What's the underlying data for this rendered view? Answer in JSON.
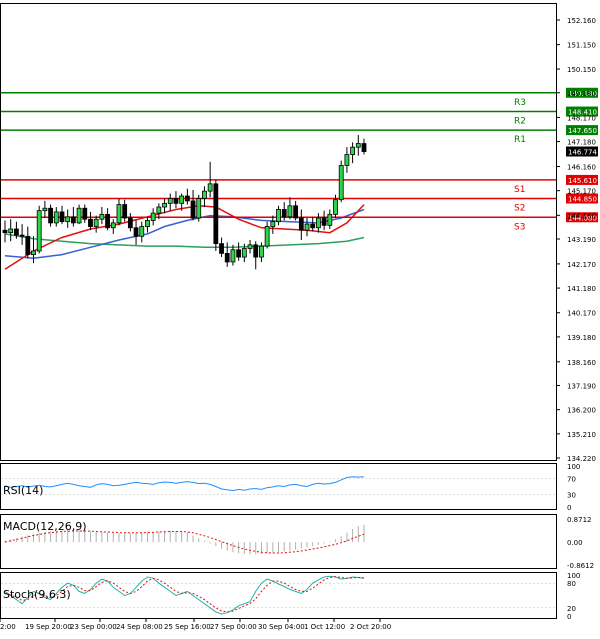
{
  "chart_data": {
    "type": "candlestick",
    "title": "",
    "price_axis": {
      "ticks": [
        "152.160",
        "151.150",
        "150.150",
        "149.180",
        "148.170",
        "147.180",
        "146.160",
        "145.170",
        "144.160",
        "143.190",
        "142.170",
        "141.180",
        "140.170",
        "139.180",
        "138.160",
        "137.190",
        "136.200",
        "135.210",
        "134.220"
      ],
      "ylim": [
        134.22,
        152.16
      ]
    },
    "time_axis": {
      "labels": [
        "2:00",
        "19 Sep 20:00",
        "23 Sep 00:00",
        "24 Sep 08:00",
        "25 Sep 16:00",
        "27 Sep 00:00",
        "30 Sep 04:00",
        "1 Oct 12:00",
        "2 Oct 20:00"
      ]
    },
    "current_price": "146.774",
    "levels": [
      {
        "name": "R3",
        "value": "149.180",
        "color": "#008000"
      },
      {
        "name": "R2",
        "value": "148.410",
        "color": "#008000"
      },
      {
        "name": "R1",
        "value": "147.650",
        "color": "#008000"
      },
      {
        "name": "S1",
        "value": "145.610",
        "color": "#e00000"
      },
      {
        "name": "S2",
        "value": "144.850",
        "color": "#e00000"
      },
      {
        "name": "S3",
        "value": "144.080",
        "color": "#e00000"
      }
    ],
    "candles": [
      {
        "o": 143.55,
        "h": 143.95,
        "l": 143.05,
        "c": 143.45
      },
      {
        "o": 143.45,
        "h": 144.0,
        "l": 143.1,
        "c": 143.6
      },
      {
        "o": 143.6,
        "h": 143.9,
        "l": 143.2,
        "c": 143.35
      },
      {
        "o": 143.35,
        "h": 143.8,
        "l": 142.95,
        "c": 143.3
      },
      {
        "o": 143.3,
        "h": 143.7,
        "l": 142.4,
        "c": 142.55
      },
      {
        "o": 142.55,
        "h": 143.3,
        "l": 142.2,
        "c": 142.7
      },
      {
        "o": 142.7,
        "h": 144.55,
        "l": 142.6,
        "c": 144.35
      },
      {
        "o": 144.35,
        "h": 144.75,
        "l": 144.05,
        "c": 144.45
      },
      {
        "o": 144.45,
        "h": 144.6,
        "l": 143.7,
        "c": 143.85
      },
      {
        "o": 143.85,
        "h": 144.5,
        "l": 143.7,
        "c": 144.3
      },
      {
        "o": 144.3,
        "h": 144.55,
        "l": 143.8,
        "c": 143.9
      },
      {
        "o": 143.9,
        "h": 144.4,
        "l": 143.65,
        "c": 144.1
      },
      {
        "o": 144.1,
        "h": 144.5,
        "l": 143.7,
        "c": 143.85
      },
      {
        "o": 143.85,
        "h": 144.6,
        "l": 143.8,
        "c": 144.45
      },
      {
        "o": 144.45,
        "h": 144.6,
        "l": 143.85,
        "c": 144.0
      },
      {
        "o": 144.0,
        "h": 144.3,
        "l": 143.55,
        "c": 143.7
      },
      {
        "o": 143.7,
        "h": 144.15,
        "l": 143.45,
        "c": 144.0
      },
      {
        "o": 144.0,
        "h": 144.5,
        "l": 143.8,
        "c": 144.2
      },
      {
        "o": 144.2,
        "h": 144.45,
        "l": 143.55,
        "c": 143.65
      },
      {
        "o": 143.65,
        "h": 144.0,
        "l": 143.4,
        "c": 143.85
      },
      {
        "o": 143.85,
        "h": 144.85,
        "l": 143.75,
        "c": 144.6
      },
      {
        "o": 144.6,
        "h": 144.8,
        "l": 143.9,
        "c": 144.05
      },
      {
        "o": 144.05,
        "h": 144.25,
        "l": 143.5,
        "c": 143.65
      },
      {
        "o": 143.65,
        "h": 143.95,
        "l": 142.95,
        "c": 143.3
      },
      {
        "o": 143.3,
        "h": 143.9,
        "l": 143.05,
        "c": 143.7
      },
      {
        "o": 143.7,
        "h": 144.1,
        "l": 143.45,
        "c": 143.95
      },
      {
        "o": 143.95,
        "h": 144.45,
        "l": 143.75,
        "c": 144.25
      },
      {
        "o": 144.25,
        "h": 144.65,
        "l": 144.0,
        "c": 144.5
      },
      {
        "o": 144.5,
        "h": 144.85,
        "l": 144.25,
        "c": 144.65
      },
      {
        "o": 144.65,
        "h": 145.05,
        "l": 144.35,
        "c": 144.85
      },
      {
        "o": 144.85,
        "h": 145.15,
        "l": 144.45,
        "c": 144.65
      },
      {
        "o": 144.65,
        "h": 145.05,
        "l": 144.35,
        "c": 144.95
      },
      {
        "o": 144.95,
        "h": 145.25,
        "l": 144.6,
        "c": 144.75
      },
      {
        "o": 144.75,
        "h": 145.2,
        "l": 143.95,
        "c": 144.05
      },
      {
        "o": 144.05,
        "h": 145.0,
        "l": 143.9,
        "c": 144.85
      },
      {
        "o": 144.85,
        "h": 145.35,
        "l": 144.5,
        "c": 145.15
      },
      {
        "o": 145.15,
        "h": 146.35,
        "l": 144.9,
        "c": 145.45
      },
      {
        "o": 145.45,
        "h": 145.6,
        "l": 142.7,
        "c": 143.0
      },
      {
        "o": 143.0,
        "h": 143.25,
        "l": 142.45,
        "c": 142.6
      },
      {
        "o": 142.6,
        "h": 143.05,
        "l": 142.05,
        "c": 142.25
      },
      {
        "o": 142.25,
        "h": 142.95,
        "l": 142.1,
        "c": 142.75
      },
      {
        "o": 142.75,
        "h": 143.05,
        "l": 142.3,
        "c": 142.45
      },
      {
        "o": 142.45,
        "h": 143.0,
        "l": 142.25,
        "c": 142.8
      },
      {
        "o": 142.8,
        "h": 143.15,
        "l": 142.6,
        "c": 142.95
      },
      {
        "o": 142.95,
        "h": 143.1,
        "l": 141.95,
        "c": 142.45
      },
      {
        "o": 142.45,
        "h": 143.05,
        "l": 142.25,
        "c": 142.9
      },
      {
        "o": 142.9,
        "h": 143.9,
        "l": 142.8,
        "c": 143.7
      },
      {
        "o": 143.7,
        "h": 144.15,
        "l": 143.4,
        "c": 143.9
      },
      {
        "o": 143.9,
        "h": 144.55,
        "l": 143.75,
        "c": 144.4
      },
      {
        "o": 144.4,
        "h": 144.7,
        "l": 143.95,
        "c": 144.1
      },
      {
        "o": 144.1,
        "h": 144.9,
        "l": 144.0,
        "c": 144.55
      },
      {
        "o": 144.55,
        "h": 144.75,
        "l": 143.95,
        "c": 144.05
      },
      {
        "o": 144.05,
        "h": 144.4,
        "l": 143.15,
        "c": 143.55
      },
      {
        "o": 143.55,
        "h": 144.05,
        "l": 143.3,
        "c": 143.8
      },
      {
        "o": 143.8,
        "h": 144.1,
        "l": 143.5,
        "c": 143.65
      },
      {
        "o": 143.65,
        "h": 144.25,
        "l": 143.45,
        "c": 144.05
      },
      {
        "o": 144.05,
        "h": 144.35,
        "l": 143.55,
        "c": 143.75
      },
      {
        "o": 143.75,
        "h": 144.4,
        "l": 143.6,
        "c": 144.2
      },
      {
        "o": 144.2,
        "h": 145.0,
        "l": 144.05,
        "c": 144.8
      },
      {
        "o": 144.8,
        "h": 146.4,
        "l": 144.7,
        "c": 146.2
      },
      {
        "o": 146.2,
        "h": 146.95,
        "l": 145.9,
        "c": 146.65
      },
      {
        "o": 146.65,
        "h": 147.15,
        "l": 146.3,
        "c": 146.95
      },
      {
        "o": 146.95,
        "h": 147.45,
        "l": 146.6,
        "c": 147.1
      },
      {
        "o": 147.1,
        "h": 147.3,
        "l": 146.65,
        "c": 146.77
      }
    ],
    "ma_blue": [
      [
        0,
        142.5
      ],
      [
        5,
        142.4
      ],
      [
        10,
        142.55
      ],
      [
        15,
        142.85
      ],
      [
        20,
        143.15
      ],
      [
        25,
        143.4
      ],
      [
        28,
        143.7
      ],
      [
        32,
        143.95
      ],
      [
        36,
        144.15
      ],
      [
        40,
        144.1
      ],
      [
        45,
        143.95
      ],
      [
        50,
        143.9
      ],
      [
        55,
        143.85
      ],
      [
        59,
        144.05
      ],
      [
        63,
        144.4
      ]
    ],
    "ma_red": [
      [
        0,
        141.95
      ],
      [
        5,
        142.7
      ],
      [
        10,
        143.25
      ],
      [
        15,
        143.6
      ],
      [
        20,
        143.8
      ],
      [
        25,
        144.1
      ],
      [
        30,
        144.4
      ],
      [
        34,
        144.55
      ],
      [
        37,
        144.5
      ],
      [
        41,
        144.0
      ],
      [
        45,
        143.65
      ],
      [
        49,
        143.6
      ],
      [
        53,
        143.55
      ],
      [
        57,
        143.45
      ],
      [
        60,
        143.85
      ],
      [
        63,
        144.6
      ]
    ],
    "ma_green": [
      [
        0,
        143.4
      ],
      [
        5,
        143.2
      ],
      [
        10,
        143.1
      ],
      [
        15,
        143.0
      ],
      [
        20,
        142.95
      ],
      [
        25,
        142.9
      ],
      [
        30,
        142.9
      ],
      [
        35,
        142.85
      ],
      [
        40,
        142.85
      ],
      [
        45,
        142.9
      ],
      [
        50,
        142.95
      ],
      [
        55,
        143.0
      ],
      [
        60,
        143.1
      ],
      [
        63,
        143.25
      ]
    ],
    "rsi": {
      "label": "RSI(14)",
      "ticks": [
        "100",
        "70",
        "30",
        "0"
      ],
      "values": [
        52,
        48,
        50,
        52,
        49,
        51,
        53,
        50,
        49,
        52,
        55,
        58,
        55,
        52,
        50,
        48,
        54,
        57,
        55,
        52,
        53,
        55,
        58,
        60,
        58,
        57,
        55,
        59,
        61,
        60,
        58,
        60,
        62,
        60,
        57,
        58,
        55,
        50,
        44,
        42,
        40,
        43,
        41,
        44,
        45,
        43,
        47,
        49,
        52,
        50,
        54,
        55,
        52,
        50,
        55,
        58,
        56,
        57,
        60,
        66,
        72,
        74,
        73,
        74
      ]
    },
    "macd": {
      "label": "MACD(12,26,9)",
      "ticks": [
        "0.8712",
        "0.00",
        "-0.8612"
      ],
      "hist": [
        0.05,
        0.1,
        0.15,
        0.2,
        0.25,
        0.3,
        0.35,
        0.38,
        0.4,
        0.42,
        0.44,
        0.45,
        0.45,
        0.44,
        0.42,
        0.4,
        0.38,
        0.37,
        0.36,
        0.35,
        0.34,
        0.33,
        0.33,
        0.34,
        0.35,
        0.37,
        0.38,
        0.4,
        0.42,
        0.43,
        0.42,
        0.4,
        0.35,
        0.25,
        0.15,
        0.05,
        -0.05,
        -0.15,
        -0.25,
        -0.32,
        -0.38,
        -0.42,
        -0.45,
        -0.46,
        -0.46,
        -0.44,
        -0.42,
        -0.4,
        -0.38,
        -0.35,
        -0.32,
        -0.28,
        -0.24,
        -0.2,
        -0.15,
        -0.1,
        -0.05,
        0.02,
        0.1,
        0.22,
        0.36,
        0.5,
        0.6,
        0.65
      ],
      "signal": [
        0.0,
        0.05,
        0.1,
        0.15,
        0.2,
        0.25,
        0.29,
        0.33,
        0.36,
        0.38,
        0.4,
        0.41,
        0.42,
        0.42,
        0.42,
        0.41,
        0.4,
        0.39,
        0.38,
        0.37,
        0.36,
        0.35,
        0.35,
        0.35,
        0.35,
        0.36,
        0.37,
        0.38,
        0.39,
        0.4,
        0.4,
        0.4,
        0.38,
        0.35,
        0.3,
        0.24,
        0.17,
        0.1,
        0.02,
        -0.06,
        -0.13,
        -0.2,
        -0.26,
        -0.31,
        -0.35,
        -0.38,
        -0.4,
        -0.41,
        -0.41,
        -0.4,
        -0.38,
        -0.36,
        -0.33,
        -0.3,
        -0.26,
        -0.22,
        -0.18,
        -0.13,
        -0.08,
        -0.02,
        0.05,
        0.14,
        0.22,
        0.3
      ]
    },
    "stoch": {
      "label": "Stoch(9,6,3)",
      "ticks": [
        "100",
        "80",
        "20",
        "0"
      ],
      "main": [
        60,
        50,
        40,
        30,
        45,
        60,
        55,
        45,
        40,
        55,
        70,
        80,
        75,
        60,
        55,
        65,
        80,
        90,
        85,
        70,
        60,
        50,
        55,
        70,
        85,
        95,
        92,
        80,
        70,
        60,
        50,
        55,
        60,
        50,
        40,
        30,
        20,
        10,
        5,
        8,
        15,
        25,
        30,
        35,
        60,
        80,
        90,
        85,
        78,
        72,
        65,
        60,
        55,
        65,
        80,
        88,
        95,
        97,
        95,
        90,
        92,
        95,
        94,
        92
      ],
      "signal": [
        55,
        52,
        45,
        38,
        40,
        50,
        55,
        50,
        45,
        50,
        60,
        72,
        75,
        70,
        62,
        62,
        72,
        82,
        86,
        80,
        70,
        60,
        55,
        60,
        72,
        85,
        92,
        88,
        80,
        70,
        60,
        55,
        57,
        55,
        48,
        40,
        30,
        20,
        12,
        10,
        12,
        18,
        25,
        30,
        42,
        60,
        75,
        85,
        85,
        80,
        72,
        65,
        60,
        60,
        68,
        78,
        88,
        94,
        96,
        94,
        92,
        93,
        94,
        93
      ]
    }
  }
}
